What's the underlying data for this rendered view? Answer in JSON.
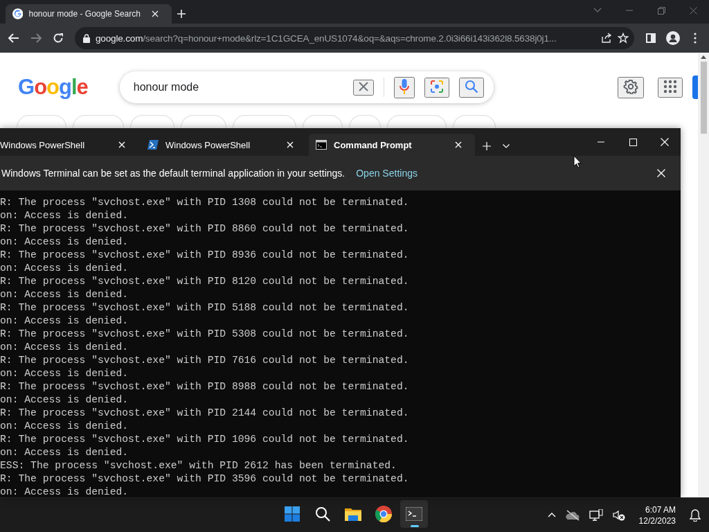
{
  "browser": {
    "tab": {
      "title": "honour mode - Google Search"
    },
    "address": {
      "domain": "google.com",
      "path": "/search?q=honour+mode&rlz=1C1GCEA_enUS1074&oq=&aqs=chrome.2.0i3i66i143i362l8.5638j0j1..."
    }
  },
  "google": {
    "logo": "Google",
    "search": {
      "value": "honour mode"
    }
  },
  "terminal": {
    "tabs": [
      {
        "title": "Windows PowerShell",
        "kind": "cut",
        "selected": false
      },
      {
        "title": "Windows PowerShell",
        "kind": "powershell",
        "selected": false
      },
      {
        "title": "Command Prompt",
        "kind": "cmd",
        "selected": true
      }
    ],
    "notice": {
      "text": "Windows Terminal can be set as the default terminal application in your settings.",
      "link": "Open Settings"
    },
    "lines": [
      "R: The process \"svchost.exe\" with PID 1308 could not be terminated.",
      "on: Access is denied.",
      "R: The process \"svchost.exe\" with PID 8860 could not be terminated.",
      "on: Access is denied.",
      "R: The process \"svchost.exe\" with PID 8936 could not be terminated.",
      "on: Access is denied.",
      "R: The process \"svchost.exe\" with PID 8120 could not be terminated.",
      "on: Access is denied.",
      "R: The process \"svchost.exe\" with PID 5188 could not be terminated.",
      "on: Access is denied.",
      "R: The process \"svchost.exe\" with PID 5308 could not be terminated.",
      "on: Access is denied.",
      "R: The process \"svchost.exe\" with PID 7616 could not be terminated.",
      "on: Access is denied.",
      "R: The process \"svchost.exe\" with PID 8988 could not be terminated.",
      "on: Access is denied.",
      "R: The process \"svchost.exe\" with PID 2144 could not be terminated.",
      "on: Access is denied.",
      "R: The process \"svchost.exe\" with PID 1096 could not be terminated.",
      "on: Access is denied.",
      "ESS: The process \"svchost.exe\" with PID 2612 has been terminated.",
      "R: The process \"svchost.exe\" with PID 3596 could not be terminated.",
      "on: Access is denied."
    ]
  },
  "taskbar": {
    "apps": [
      {
        "kind": "start",
        "active": false
      },
      {
        "kind": "search",
        "active": false
      },
      {
        "kind": "explorer",
        "active": false
      },
      {
        "kind": "chrome",
        "active": false
      },
      {
        "kind": "terminal",
        "active": true
      }
    ],
    "time": "6:07 AM",
    "date": "12/2/2023"
  }
}
